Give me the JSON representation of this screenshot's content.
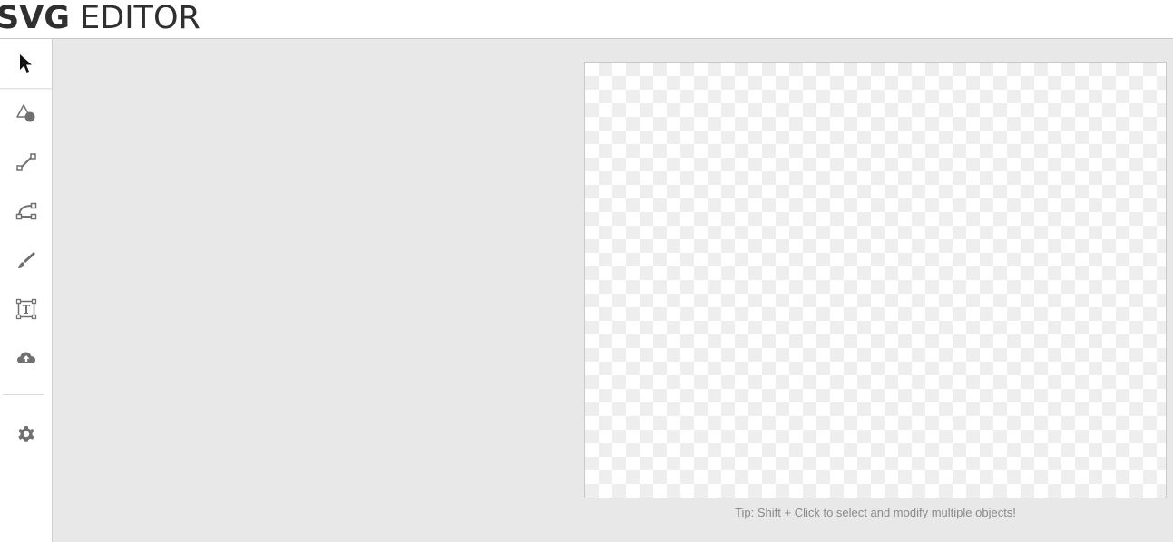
{
  "header": {
    "logo_bold": "SVG",
    "logo_light": "EDITOR"
  },
  "sidebar": {
    "tools": [
      {
        "icon": "cursor-arrow-icon",
        "active": true
      },
      {
        "icon": "shapes-icon"
      },
      {
        "icon": "line-icon"
      },
      {
        "icon": "bezier-path-icon"
      },
      {
        "icon": "brush-icon"
      },
      {
        "icon": "text-tool-icon"
      },
      {
        "icon": "cloud-upload-icon"
      },
      {
        "icon": "gear-icon"
      }
    ]
  },
  "workspace": {
    "tip": "Tip: Shift + Click to select and modify multiple objects!"
  },
  "colors": {
    "workspace_bg": "#e8e8e8",
    "icon_color": "#707070",
    "active_icon_color": "#111111",
    "tip_color": "#8a8a8a"
  }
}
